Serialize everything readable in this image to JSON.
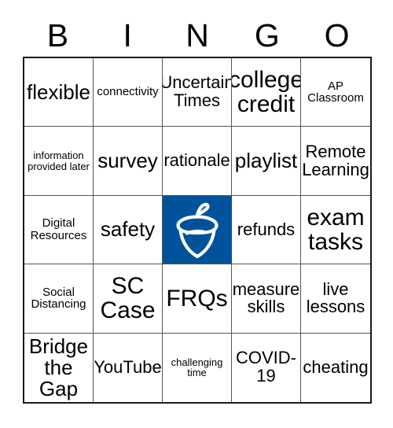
{
  "header": {
    "letters": [
      "B",
      "I",
      "N",
      "G",
      "O"
    ]
  },
  "grid": {
    "rows": [
      [
        {
          "text": "flexible",
          "size": "fs-lg"
        },
        {
          "text": "connectivity",
          "size": "fs-xs"
        },
        {
          "text": "Uncertain Times",
          "size": "fs-md"
        },
        {
          "text": "college credit",
          "size": "fs-xl"
        },
        {
          "text": "AP Classroom",
          "size": "fs-xs"
        }
      ],
      [
        {
          "text": "information provided later",
          "size": "fs-xxs"
        },
        {
          "text": "survey",
          "size": "fs-lg"
        },
        {
          "text": "rationale",
          "size": "fs-md"
        },
        {
          "text": "playlist",
          "size": "fs-lg"
        },
        {
          "text": "Remote Learning",
          "size": "fs-md"
        }
      ],
      [
        {
          "text": "Digital Resources",
          "size": "fs-xs"
        },
        {
          "text": "safety",
          "size": "fs-lg"
        },
        {
          "text": "",
          "size": "fs-md",
          "free": true,
          "icon": "acorn-icon"
        },
        {
          "text": "refunds",
          "size": "fs-md"
        },
        {
          "text": "exam tasks",
          "size": "fs-xl"
        }
      ],
      [
        {
          "text": "Social Distancing",
          "size": "fs-xs"
        },
        {
          "text": "SC Case",
          "size": "fs-xl"
        },
        {
          "text": "FRQs",
          "size": "fs-xl"
        },
        {
          "text": "measure skills",
          "size": "fs-md"
        },
        {
          "text": "live lessons",
          "size": "fs-md"
        }
      ],
      [
        {
          "text": "Bridge the Gap",
          "size": "fs-lg"
        },
        {
          "text": "YouTube",
          "size": "fs-md"
        },
        {
          "text": "challenging time",
          "size": "fs-xxs"
        },
        {
          "text": "COVID-19",
          "size": "fs-md"
        },
        {
          "text": "cheating",
          "size": "fs-md"
        }
      ]
    ]
  },
  "colors": {
    "free_space_background": "#00539B",
    "free_space_icon": "#FFFFFF",
    "grid_line": "#555555",
    "outer_border": "#1A1A1A",
    "text": "#000000",
    "page_background": "#FFFFFF"
  }
}
